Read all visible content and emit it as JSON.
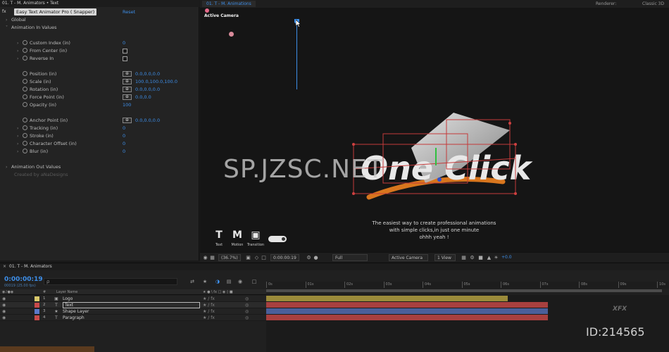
{
  "effect_controls": {
    "tab_title": "01. T - M. Animators  •  Text",
    "fx_badge": "fx",
    "effect_name": "Easy Text Animator Pro ( Snapper)",
    "reset_label": "Reset",
    "rows": [
      {
        "label": "Global",
        "kind": "group"
      },
      {
        "label": "Animation In Values",
        "kind": "group-open"
      },
      {
        "label": "Custom Index (in)",
        "kind": "value",
        "value": "0"
      },
      {
        "label": "From Center (in)",
        "kind": "checkbox"
      },
      {
        "label": "Reverse In",
        "kind": "checkbox"
      },
      {
        "label": "Position (in)",
        "kind": "xy",
        "value": "0.0,0.0,0.0"
      },
      {
        "label": "Scale (in)",
        "kind": "xy",
        "value": "100.0,100.0,100.0"
      },
      {
        "label": "Rotation (in)",
        "kind": "xy",
        "value": "0.0,0.0,0.0"
      },
      {
        "label": "Force Point (in)",
        "kind": "xy",
        "value": "0.0,0.0"
      },
      {
        "label": "Opacity (in)",
        "kind": "value",
        "value": "100"
      },
      {
        "label": "Anchor Point (in)",
        "kind": "xy",
        "value": "0.0,0.0,0.0"
      },
      {
        "label": "Tracking (in)",
        "kind": "value",
        "value": "0"
      },
      {
        "label": "Stroke (in)",
        "kind": "value",
        "value": "0"
      },
      {
        "label": "Character Offset (in)",
        "kind": "value",
        "value": "0"
      },
      {
        "label": "Blur (in)",
        "kind": "value",
        "value": "0"
      },
      {
        "label": "Animation Out Values",
        "kind": "group"
      },
      {
        "label": "Created by aNaDesigns",
        "kind": "credit"
      }
    ]
  },
  "viewer": {
    "tab_label": "01. T - M. Animations",
    "renderer_label": "Renderer:",
    "renderer_value": "Classic 3D",
    "active_camera": "Active Camera",
    "artwork_text": "One Click",
    "tagline": [
      "The easiest way to create professional animations",
      "with simple clicks,in just one minute",
      "ohhh yeah !"
    ],
    "watermark": "SP.JZSC.NET",
    "palette": [
      {
        "glyph": "T",
        "label": "Text"
      },
      {
        "glyph": "M",
        "label": "Motion"
      },
      {
        "glyph": "▣",
        "label": "Transition"
      }
    ],
    "toolbar": {
      "zoom": "(36.7%)",
      "timecode": "0:00:00:19",
      "resolution": "Full",
      "camera": "Active Camera",
      "views": "1 View",
      "exposure": "+0.0"
    }
  },
  "timeline": {
    "tab_title": "01. T - M. Animators",
    "timecode": "0:00:00:19",
    "frame_sub": "00019 (25.00 fps)",
    "search_placeholder": "ρ",
    "col_layer_name": "Layer Name",
    "col_number": "#",
    "layers": [
      {
        "num": "1",
        "type": "▣",
        "name": "Logo",
        "color": "#d8c86a"
      },
      {
        "num": "2",
        "type": "T",
        "name": "Text",
        "color": "#c84a4a"
      },
      {
        "num": "3",
        "type": "★",
        "name": "Shape Layer",
        "color": "#5a78c8"
      },
      {
        "num": "4",
        "type": "T",
        "name": "Paragraph",
        "color": "#c84a4a"
      }
    ],
    "ruler_ticks": [
      "0s",
      "01s",
      "02s",
      "03s",
      "04s",
      "05s",
      "06s",
      "07s",
      "08s",
      "09s",
      "10s"
    ],
    "bars": [
      {
        "color": "#9a8a3a",
        "start": 0.0,
        "end": 0.6
      },
      {
        "color": "#a8403f",
        "start": 0.0,
        "end": 0.7
      },
      {
        "color": "#4a5f9a",
        "start": 0.0,
        "end": 0.7
      },
      {
        "color": "#a8403f",
        "start": 0.0,
        "end": 0.7
      }
    ],
    "playhead_fraction": 0.075
  },
  "overlay": {
    "id_text": "ID:214565",
    "logo_text": "XFX"
  }
}
